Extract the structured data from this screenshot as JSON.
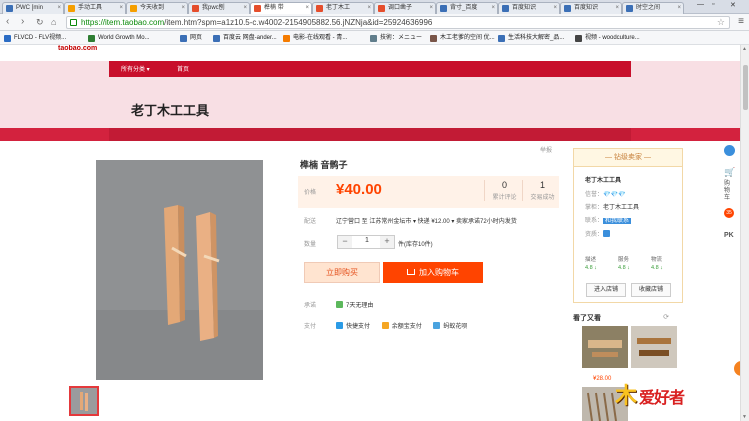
{
  "browser": {
    "tabs": [
      {
        "label": "PWC [min",
        "color": "#3b6fb6"
      },
      {
        "label": "手动工具",
        "color": "#f59f00"
      },
      {
        "label": "今天收到",
        "color": "#f59f00"
      },
      {
        "label": "我pwc刨",
        "color": "#e54e2c"
      },
      {
        "label": "榫楠 带",
        "color": "#e54e2c"
      },
      {
        "label": "老丁木工",
        "color": "#e54e2c"
      },
      {
        "label": "调口凿子",
        "color": "#e54e2c"
      },
      {
        "label": "背寸_百度",
        "color": "#3b6fb6"
      },
      {
        "label": "百度知识",
        "color": "#3b6fb6"
      },
      {
        "label": "百度知识",
        "color": "#3b6fb6"
      },
      {
        "label": "时空之间",
        "color": "#3b6fb6"
      }
    ],
    "active_tab_index": 4,
    "url_host": "https://item.taobao.com",
    "url_rest": "/item.htm?spm=a1z10.5-c.w4002-2154905882.56.jNZNja&id=25924636996",
    "bookmarks": [
      {
        "label": "FLVCD - FLV视频...",
        "color": "#2b6cc4"
      },
      {
        "label": "World Growth Mo...",
        "color": "#2e7d32"
      },
      {
        "label": "网页",
        "color": "#3b6fb6"
      },
      {
        "label": "百度云 网盘-ander...",
        "color": "#3b6fb6"
      },
      {
        "label": "电影-在线观看 - 青...",
        "color": "#f57c00"
      },
      {
        "label": "技術：メニュー",
        "color": "#607d8b"
      },
      {
        "label": "木工老爹的空间 优...",
        "color": "#795548"
      },
      {
        "label": "生活科技大解密_品...",
        "color": "#3b6fb6"
      },
      {
        "label": "视频 - woodculture...",
        "color": "#444"
      }
    ]
  },
  "shop": {
    "domain_logo": "taobao.com",
    "nav": [
      "所有分类 ▾",
      "首页"
    ],
    "name": "老丁木工工具"
  },
  "product": {
    "title": "榫楠 音鹘子",
    "report": "举报",
    "price_label": "价格",
    "price": "¥40.00",
    "reviews_count": "0",
    "reviews_label": "累计评论",
    "sales_count": "1",
    "sales_label": "交易成功",
    "shipping_label": "配送",
    "shipping_text": "辽宁营口 至  江苏常州金坛市 ▾  快递 ¥12.00 ▾   卖家承诺72小时内发货",
    "quantity_label": "数量",
    "quantity": "1",
    "stock_text": "件(库存10件)",
    "buy_now": "立即购买",
    "add_cart": "加入购物车",
    "promise_label": "承诺",
    "promise_text": "7天无理由",
    "payment_label": "支付",
    "payments": [
      "快捷支付",
      "余额宝支付",
      "蚂蚁花呗"
    ]
  },
  "seller": {
    "header": "钻级卖家",
    "name": "老丁木工工具",
    "credit_label": "信誉：",
    "credit_icons": "💎💎💎",
    "owner_label": "掌柜：",
    "owner": "老丁木工工具",
    "contact_label": "联系：",
    "contact": "和我联系",
    "qual_label": "资质：",
    "scores": [
      {
        "label": "描述",
        "value": "4.8 ↓"
      },
      {
        "label": "服务",
        "value": "4.8 ↓"
      },
      {
        "label": "物流",
        "value": "4.8 ↓"
      }
    ],
    "enter_shop": "进入店铺",
    "fav_shop": "收藏店铺"
  },
  "similar": {
    "header": "看了又看",
    "refresh": "⟳",
    "price": "¥28.00"
  },
  "toolbar": {
    "cart": "购物车",
    "cart_count": "35",
    "pk": "PK"
  },
  "watermark": {
    "mark": "木",
    "text": "爱好者"
  }
}
